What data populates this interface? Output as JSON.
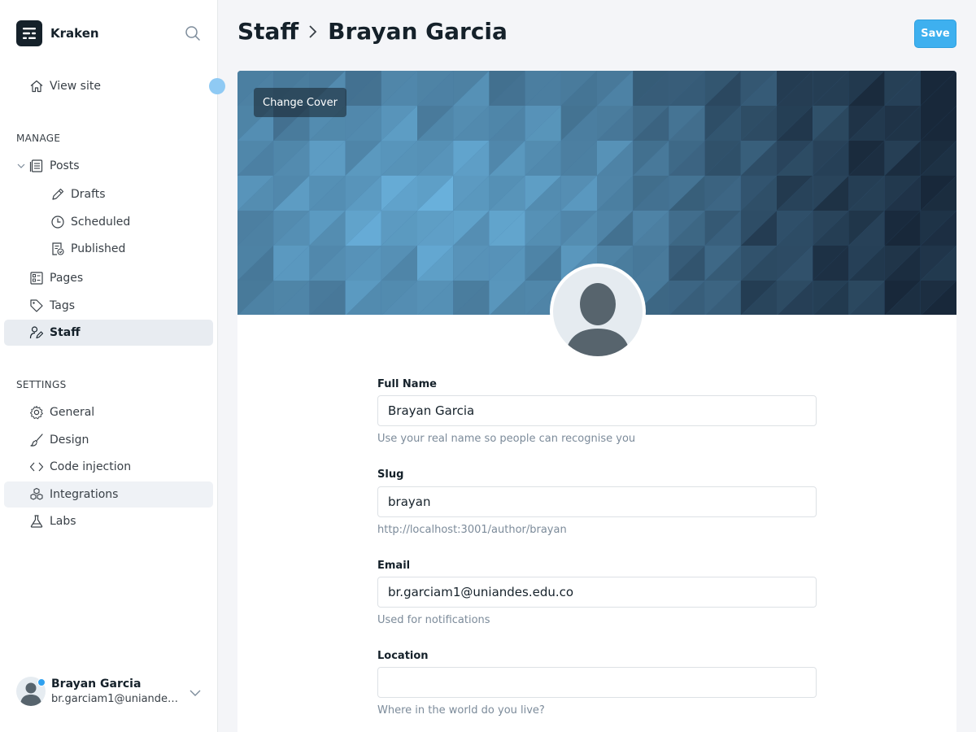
{
  "brand": {
    "name": "Kraken"
  },
  "sidebar": {
    "view_site": "View site",
    "manage_title": "MANAGE",
    "posts": "Posts",
    "drafts": "Drafts",
    "scheduled": "Scheduled",
    "published": "Published",
    "pages": "Pages",
    "tags": "Tags",
    "staff": "Staff",
    "settings_title": "SETTINGS",
    "general": "General",
    "design": "Design",
    "code_injection": "Code injection",
    "integrations": "Integrations",
    "labs": "Labs"
  },
  "user": {
    "name": "Brayan Garcia",
    "email": "br.garciam1@uniandes.edu.co"
  },
  "header": {
    "crumb_parent": "Staff",
    "crumb_current": "Brayan Garcia",
    "save_label": "Save"
  },
  "profile": {
    "change_cover": "Change Cover",
    "full_name_label": "Full Name",
    "full_name_value": "Brayan Garcia",
    "full_name_help": "Use your real name so people can recognise you",
    "slug_label": "Slug",
    "slug_value": "brayan",
    "slug_help": "http://localhost:3001/author/brayan",
    "email_label": "Email",
    "email_value": "br.garciam1@uniandes.edu.co",
    "email_help": "Used for notifications",
    "location_label": "Location",
    "location_value": "",
    "location_help": "Where in the world do you live?"
  },
  "colors": {
    "accent": "#3eb0ef",
    "active_nav_bg": "#e8ecf1",
    "cover_dark": "#1a2a3a",
    "cover_light": "#6ab4e0"
  }
}
